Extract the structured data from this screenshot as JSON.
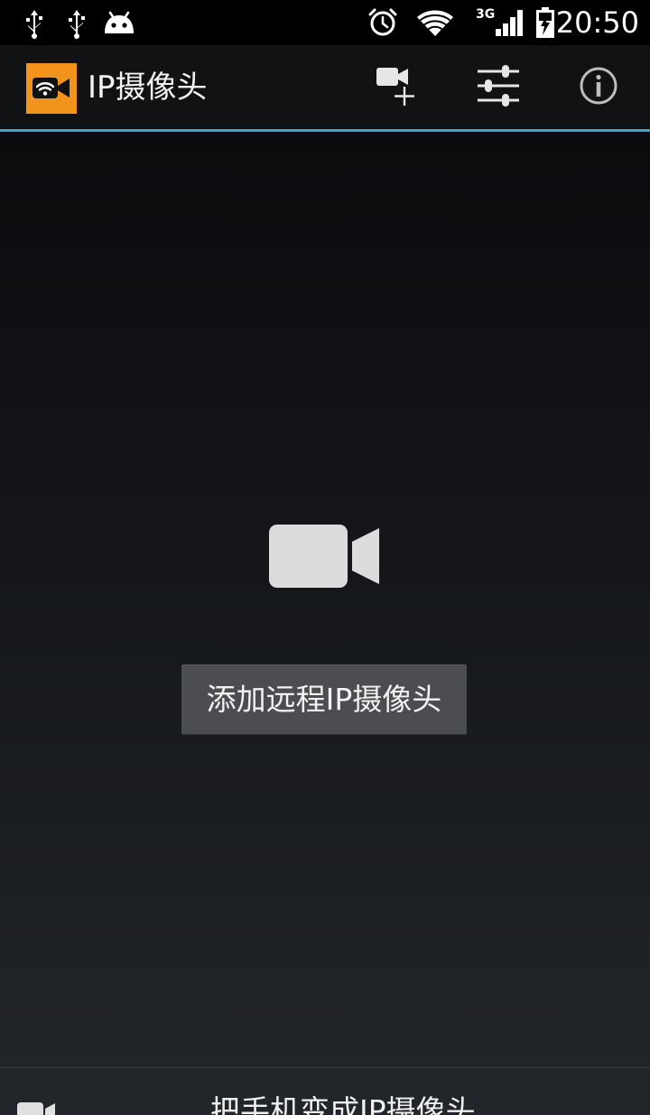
{
  "status_bar": {
    "time": "20:50",
    "network_type": "3G",
    "icons": [
      "usb-icon",
      "usb-icon",
      "android-debug-icon",
      "alarm-icon",
      "wifi-icon",
      "signal-icon",
      "battery-charging-icon"
    ]
  },
  "action_bar": {
    "title": "IP摄像头",
    "logo_icon": "camera-wifi-logo",
    "actions": [
      "add-camera-icon",
      "settings-sliders-icon",
      "info-icon"
    ],
    "accent_color": "#3fa4d9"
  },
  "main": {
    "placeholder_icon": "video-camera-icon",
    "add_remote_button_label": "添加远程IP摄像头"
  },
  "bottom_bar": {
    "icon": "video-camera-icon",
    "label": "把手机变成IP摄像头"
  },
  "colors": {
    "logo_background": "#f2941c",
    "button_background": "#4b4d51"
  }
}
